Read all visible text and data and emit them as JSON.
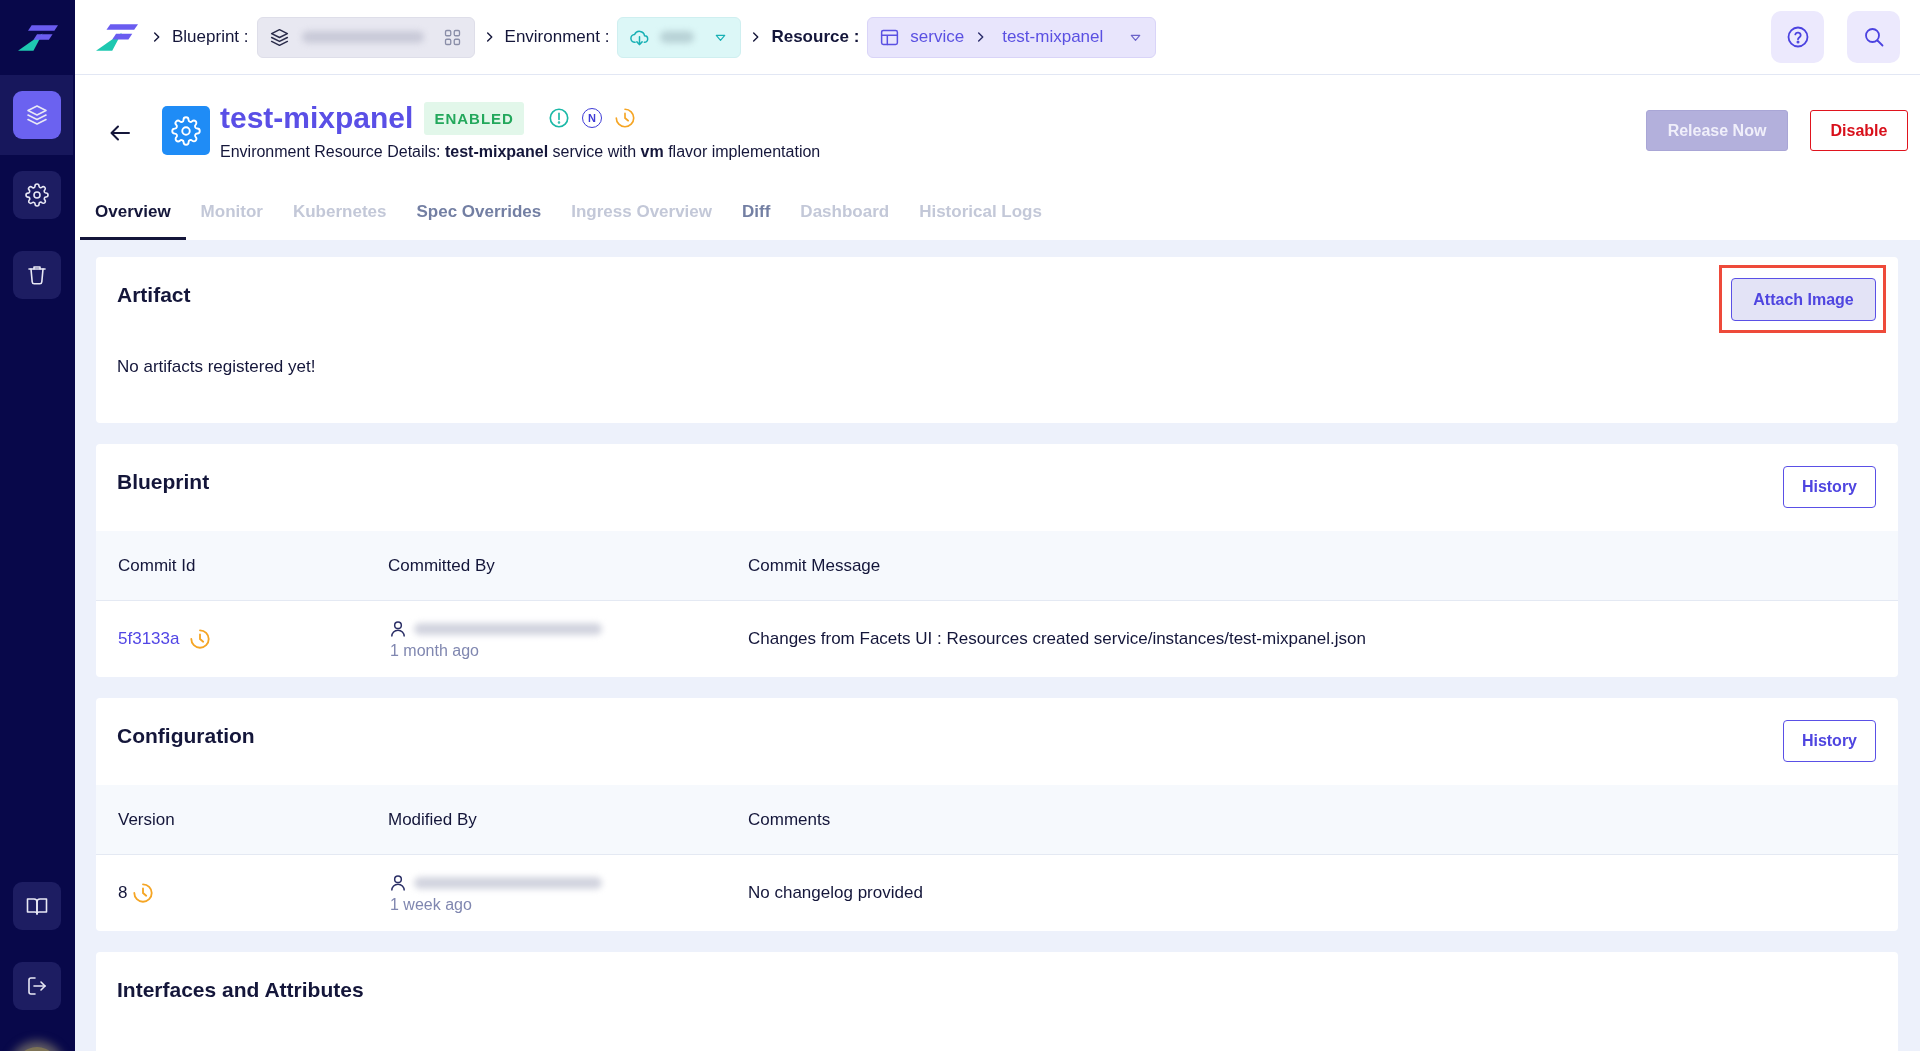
{
  "sidebar": {
    "items": [
      {
        "selected": true
      },
      {
        "selected": false
      },
      {
        "selected": false
      }
    ]
  },
  "breadcrumb": {
    "blueprint": {
      "label": "Blueprint :"
    },
    "environment": {
      "label": "Environment :"
    },
    "resource": {
      "label": "Resource :",
      "type": "service",
      "name": "test-mixpanel"
    }
  },
  "resource": {
    "title": "test-mixpanel",
    "status": "ENABLED",
    "badge_letter": "N",
    "description": "Environment Resource Details: **test-mixpanel** service with **vm** flavor implementation"
  },
  "actions": [
    {
      "label": "Release Now",
      "kind": "primary",
      "disabled": true
    },
    {
      "label": "Disable",
      "kind": "danger",
      "disabled": false
    }
  ],
  "tabs": [
    {
      "label": "Overview",
      "selected": true,
      "disabled": false
    },
    {
      "label": "Monitor",
      "selected": false,
      "disabled": true
    },
    {
      "label": "Kubernetes",
      "selected": false,
      "disabled": true
    },
    {
      "label": "Spec Overrides",
      "selected": false,
      "disabled": false
    },
    {
      "label": "Ingress Overview",
      "selected": false,
      "disabled": true
    },
    {
      "label": "Diff",
      "selected": false,
      "disabled": false
    },
    {
      "label": "Dashboard",
      "selected": false,
      "disabled": true
    },
    {
      "label": "Historical Logs",
      "selected": false,
      "disabled": true
    }
  ],
  "artifact": {
    "title": "Artifact",
    "button": {
      "label": "Attach Image",
      "highlighted": true
    },
    "empty_text": "No artifacts registered yet!"
  },
  "blueprint": {
    "title": "Blueprint",
    "button": "History",
    "columns": [
      "Commit Id",
      "Committed By",
      "Commit Message"
    ],
    "rows": [
      {
        "commit_id": "5f3133a",
        "time": "1 month ago",
        "message": "Changes from Facets UI : Resources created service/instances/test-mixpanel.json"
      }
    ]
  },
  "configuration": {
    "title": "Configuration",
    "button": "History",
    "columns": [
      "Version",
      "Modified By",
      "Comments"
    ],
    "rows": [
      {
        "version": "8",
        "time": "1 week ago",
        "comment": "No changelog provided"
      }
    ]
  },
  "interfaces": {
    "title": "Interfaces and Attributes"
  }
}
